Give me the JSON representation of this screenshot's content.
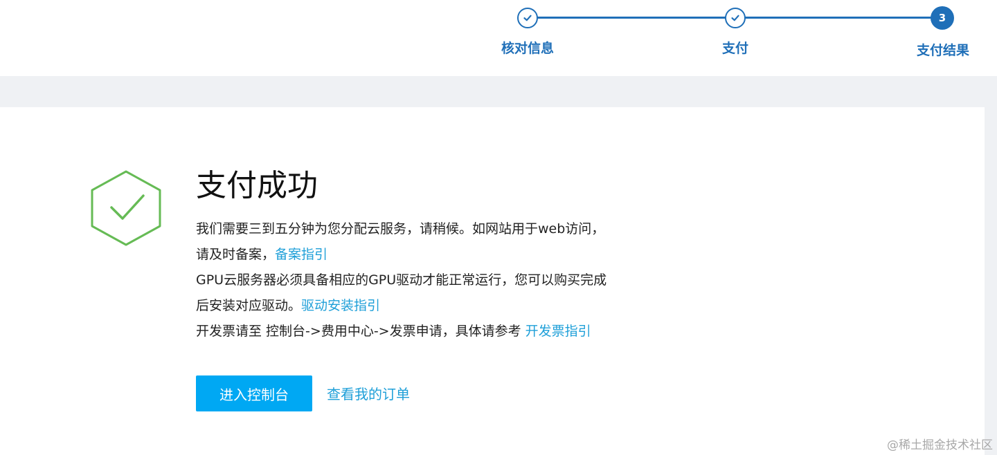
{
  "stepper": {
    "steps": [
      {
        "label": "核对信息",
        "status": "done"
      },
      {
        "label": "支付",
        "status": "done"
      },
      {
        "label": "支付结果",
        "status": "active",
        "number": "3"
      }
    ],
    "color": "#1f6fb8"
  },
  "result": {
    "icon": "hexagon-check-icon",
    "icon_color": "#66bb55",
    "title": "支付成功",
    "lines": {
      "l1": "我们需要三到五分钟为您分配云服务，请稍候。如网站用于web访问，",
      "l2_text": "请及时备案，",
      "l2_link": "备案指引",
      "l3": "GPU云服务器必须具备相应的GPU驱动才能正常运行，您可以购买完成",
      "l4_text": "后安装对应驱动。",
      "l4_link": "驱动安装指引",
      "l5_text": "开发票请至 控制台->费用中心->发票申请，具体请参考 ",
      "l5_link": "开发票指引"
    },
    "link_color": "#1e9fd8"
  },
  "actions": {
    "console_button": "进入控制台",
    "orders_link": "查看我的订单",
    "button_color": "#00a8f3"
  },
  "watermark": "@稀土掘金技术社区"
}
